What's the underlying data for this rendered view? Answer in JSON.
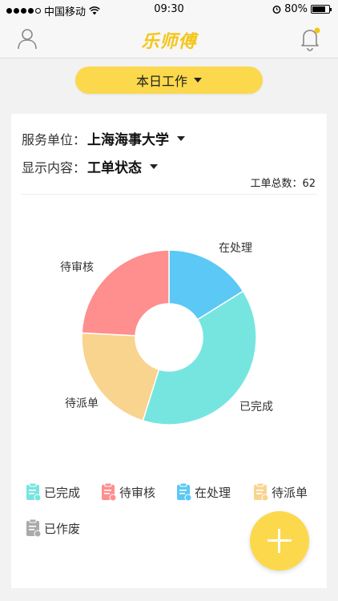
{
  "status_bar": {
    "carrier": "中国移动",
    "time": "09:30",
    "battery": "80%",
    "battery_level": 0.8
  },
  "navbar": {
    "logo": "乐师傅",
    "user_icon": "user-icon",
    "bell_icon": "bell-icon",
    "notification_color": "#f5c518"
  },
  "period_select": {
    "label": "本日工作"
  },
  "filters": {
    "unit_label": "服务单位：",
    "unit_value": "上海海事大学",
    "content_label": "显示内容：",
    "content_value": "工单状态"
  },
  "summary": {
    "total_label": "工单总数：",
    "total_value": "62"
  },
  "chart_data": {
    "type": "pie",
    "donut": true,
    "slices": [
      {
        "label": "在处理",
        "value": 10,
        "color": "#5bc8f5"
      },
      {
        "label": "已完成",
        "value": 24,
        "color": "#76e5e0"
      },
      {
        "label": "待派单",
        "value": 13,
        "color": "#f9d48e"
      },
      {
        "label": "待审核",
        "value": 15,
        "color": "#ff8e8e"
      }
    ]
  },
  "legend": [
    {
      "label": "已完成",
      "color": "#76e5e0",
      "icon": "clipboard-check-icon"
    },
    {
      "label": "待审核",
      "color": "#ff8e8e",
      "icon": "clipboard-clock-icon"
    },
    {
      "label": "在处理",
      "color": "#5bc8f5",
      "icon": "clipboard-edit-icon"
    },
    {
      "label": "待派单",
      "color": "#f9d48e",
      "icon": "clipboard-list-icon"
    },
    {
      "label": "已作废",
      "color": "#aaaaaa",
      "icon": "clipboard-void-icon"
    }
  ],
  "fab": {
    "icon": "plus-icon"
  }
}
